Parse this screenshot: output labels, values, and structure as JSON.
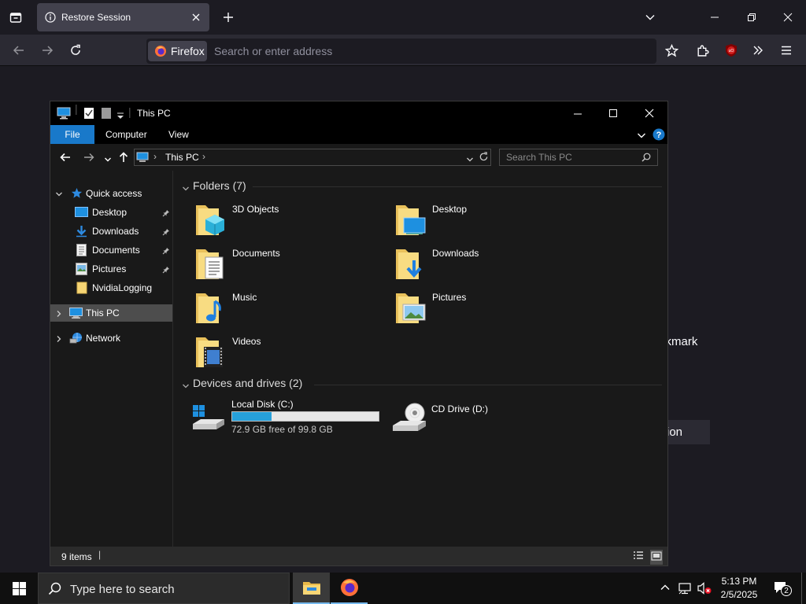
{
  "browser": {
    "tab_title": "Restore Session",
    "identity_label": "Firefox",
    "address_placeholder": "Search or enter address",
    "colors": {
      "chrome": "#1c1b22",
      "navbar": "#2b2a33",
      "tab_active": "#42414d"
    }
  },
  "background_page": {
    "partial_text": "ckmark",
    "partial_button": "ssion"
  },
  "explorer": {
    "title": "This PC",
    "ribbon": {
      "file": "File",
      "computer": "Computer",
      "view": "View"
    },
    "address": {
      "crumb": "This PC"
    },
    "search_placeholder": "Search This PC",
    "nav": {
      "quick_access": "Quick access",
      "items": [
        {
          "label": "Desktop",
          "icon": "desktop-icon",
          "pinned": true
        },
        {
          "label": "Downloads",
          "icon": "downloads-icon",
          "pinned": true
        },
        {
          "label": "Documents",
          "icon": "documents-icon",
          "pinned": true
        },
        {
          "label": "Pictures",
          "icon": "pictures-icon",
          "pinned": true
        },
        {
          "label": "NvidiaLogging",
          "icon": "folder-icon",
          "pinned": false
        }
      ],
      "this_pc": "This PC",
      "network": "Network"
    },
    "folders_header": "Folders (7)",
    "folders": [
      {
        "label": "3D Objects",
        "icon": "3d-objects-folder-icon"
      },
      {
        "label": "Desktop",
        "icon": "desktop-folder-icon"
      },
      {
        "label": "Documents",
        "icon": "documents-folder-icon"
      },
      {
        "label": "Downloads",
        "icon": "downloads-folder-icon"
      },
      {
        "label": "Music",
        "icon": "music-folder-icon"
      },
      {
        "label": "Pictures",
        "icon": "pictures-folder-icon"
      },
      {
        "label": "Videos",
        "icon": "videos-folder-icon"
      }
    ],
    "drives_header": "Devices and drives (2)",
    "drives": [
      {
        "label": "Local Disk (C:)",
        "free_text": "72.9 GB free of 99.8 GB",
        "used_fraction": 0.27
      },
      {
        "label": "CD Drive (D:)"
      }
    ],
    "status": "9 items",
    "colors": {
      "accent": "#1979ca",
      "usage_bar": "#26a0da",
      "selection": "#4d4d4d"
    }
  },
  "taskbar": {
    "search_placeholder": "Type here to search",
    "time": "5:13 PM",
    "date": "2/5/2025",
    "notification_count": "2"
  }
}
